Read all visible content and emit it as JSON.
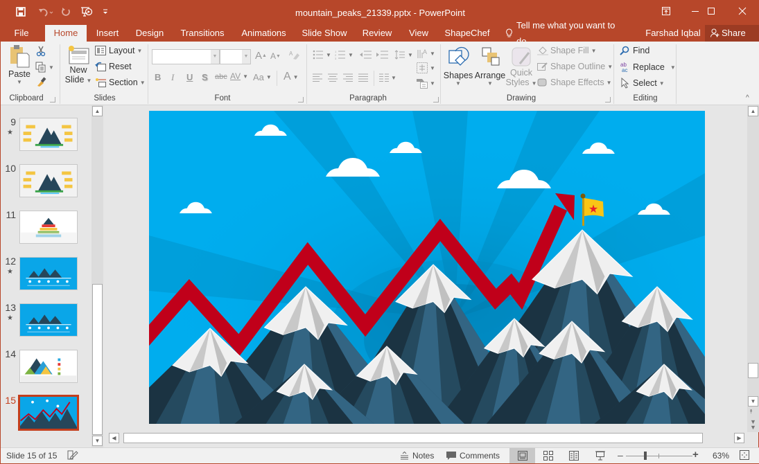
{
  "window": {
    "title": "mountain_peaks_21339.pptx - PowerPoint",
    "controls": {
      "ribbon_display": "ribbon-display-options-icon",
      "minimize": "minimize-icon",
      "maximize": "maximize-icon",
      "close": "close-icon"
    }
  },
  "quick_access": [
    "save-icon",
    "undo-icon",
    "redo-icon",
    "start-from-beginning-icon",
    "customize-qat-icon"
  ],
  "tabs": [
    {
      "label": "File",
      "active": false
    },
    {
      "label": "Home",
      "active": true
    },
    {
      "label": "Insert",
      "active": false
    },
    {
      "label": "Design",
      "active": false
    },
    {
      "label": "Transitions",
      "active": false
    },
    {
      "label": "Animations",
      "active": false
    },
    {
      "label": "Slide Show",
      "active": false
    },
    {
      "label": "Review",
      "active": false
    },
    {
      "label": "View",
      "active": false
    },
    {
      "label": "ShapeChef",
      "active": false
    }
  ],
  "tell_me": "Tell me what you want to do...",
  "user": "Farshad Iqbal",
  "share_label": "Share",
  "ribbon": {
    "clipboard": {
      "label": "Clipboard",
      "paste": "Paste"
    },
    "slides": {
      "label": "Slides",
      "new_slide_1": "New",
      "new_slide_2": "Slide",
      "layout": "Layout",
      "reset": "Reset",
      "section": "Section"
    },
    "font": {
      "label": "Font",
      "font_name": "",
      "font_size": "",
      "bold": "B",
      "italic": "I",
      "underline": "U",
      "shadow": "S",
      "strike": "abc",
      "spacing": "AV",
      "case": "Aa",
      "color": "A"
    },
    "paragraph": {
      "label": "Paragraph"
    },
    "drawing": {
      "label": "Drawing",
      "shapes": "Shapes",
      "arrange": "Arrange",
      "quick_styles_1": "Quick",
      "quick_styles_2": "Styles",
      "shape_fill": "Shape Fill",
      "shape_outline": "Shape Outline",
      "shape_effects": "Shape Effects"
    },
    "editing": {
      "label": "Editing",
      "find": "Find",
      "replace": "Replace",
      "select": "Select"
    }
  },
  "thumbnails": [
    {
      "number": "9",
      "starred": true,
      "style": "light"
    },
    {
      "number": "10",
      "starred": false,
      "style": "light"
    },
    {
      "number": "11",
      "starred": false,
      "style": "white"
    },
    {
      "number": "12",
      "starred": true,
      "style": "blue"
    },
    {
      "number": "13",
      "starred": true,
      "style": "blue"
    },
    {
      "number": "14",
      "starred": false,
      "style": "white"
    },
    {
      "number": "15",
      "starred": false,
      "style": "current",
      "selected": true
    }
  ],
  "slide": {
    "colors": {
      "sky": "#00adee",
      "arrow": "#c0001a",
      "flag": "#f9c516",
      "star": "#e8202a",
      "mountain_dark": "#1b3342",
      "mountain_mid": "#254a5f",
      "mountain_light": "#336583",
      "snow": "#f0f0f0"
    }
  },
  "status": {
    "slide_indicator": "Slide 15 of 15",
    "notes": "Notes",
    "comments": "Comments",
    "zoom": "63%",
    "zoom_level_percent": 63
  }
}
